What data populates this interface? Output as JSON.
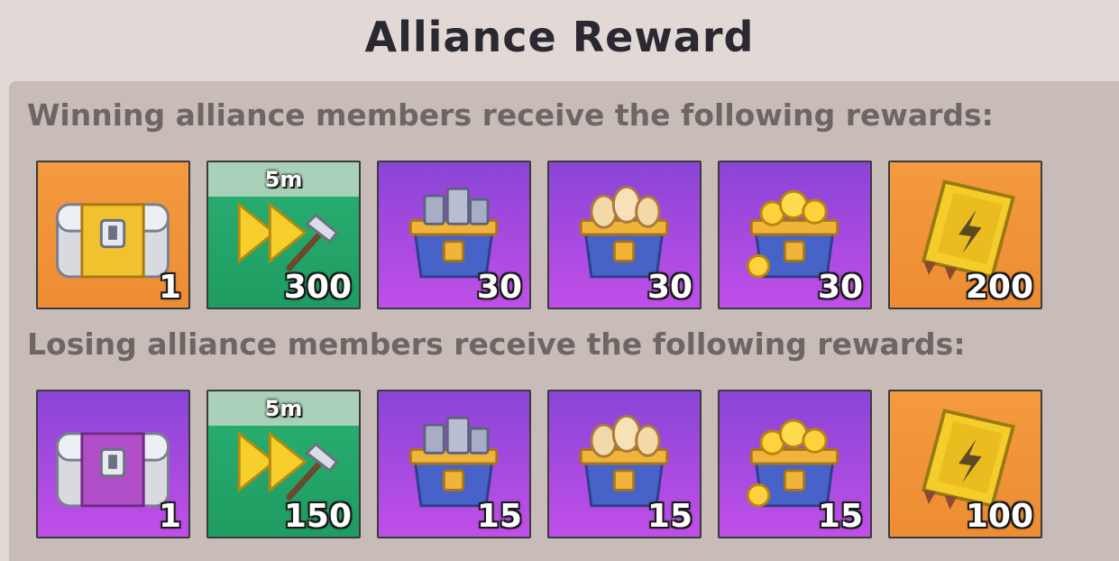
{
  "header": {
    "title": "Alliance Reward"
  },
  "sections": [
    {
      "label": "Winning alliance members receive the following rewards:",
      "items": [
        {
          "icon": "gold-chest-icon",
          "bg": "orange",
          "quantity": "1"
        },
        {
          "icon": "speedup-hammer-icon",
          "bg": "green",
          "badge": "5m",
          "quantity": "300"
        },
        {
          "icon": "iron-crate-icon",
          "bg": "purple",
          "quantity": "30"
        },
        {
          "icon": "bread-crate-icon",
          "bg": "purple",
          "quantity": "30"
        },
        {
          "icon": "coin-crate-icon",
          "bg": "purple",
          "quantity": "30"
        },
        {
          "icon": "energy-card-icon",
          "bg": "orange",
          "quantity": "200"
        }
      ]
    },
    {
      "label": "Losing alliance members receive the following rewards:",
      "items": [
        {
          "icon": "purple-chest-icon",
          "bg": "purple",
          "quantity": "1"
        },
        {
          "icon": "speedup-hammer-icon",
          "bg": "green",
          "badge": "5m",
          "quantity": "150"
        },
        {
          "icon": "iron-crate-icon",
          "bg": "purple",
          "quantity": "15"
        },
        {
          "icon": "bread-crate-icon",
          "bg": "purple",
          "quantity": "15"
        },
        {
          "icon": "coin-crate-icon",
          "bg": "purple",
          "quantity": "15"
        },
        {
          "icon": "energy-card-icon",
          "bg": "orange",
          "quantity": "100"
        }
      ]
    }
  ]
}
